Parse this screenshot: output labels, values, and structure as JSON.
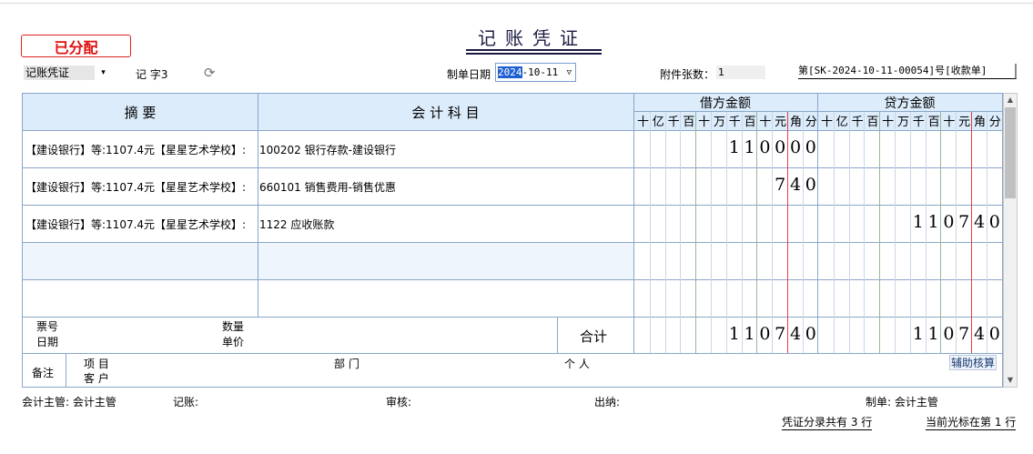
{
  "stamp": "已分配",
  "title": "记账凭证",
  "voucher_type": "记账凭证",
  "word_label": "记 字3",
  "date_label": "制单日期",
  "date_year": "2024",
  "date_rest": "-10-11",
  "attach_label": "附件张数：",
  "attach_value": "1",
  "voucher_no": "第[SK-2024-10-11-00054]号[收款单]",
  "headers": {
    "summary": "摘  要",
    "account": "会 计 科 目",
    "debit": "借方金额",
    "credit": "贷方金额",
    "units": [
      "十",
      "亿",
      "千",
      "百",
      "十",
      "万",
      "千",
      "百",
      "十",
      "元",
      "角",
      "分"
    ]
  },
  "rows": [
    {
      "summary": "【建设银行】等:1107.4元【星星艺术学校】:",
      "account": "100202 银行存款-建设银行",
      "debit": "110000",
      "credit": ""
    },
    {
      "summary": "【建设银行】等:1107.4元【星星艺术学校】:",
      "account": "660101 销售费用-销售优惠",
      "debit": "740",
      "credit": ""
    },
    {
      "summary": "【建设银行】等:1107.4元【星星艺术学校】:",
      "account": "1122 应收账款",
      "debit": "",
      "credit": "110740"
    },
    {
      "summary": "",
      "account": "",
      "debit": "",
      "credit": ""
    },
    {
      "summary": "",
      "account": "",
      "debit": "",
      "credit": ""
    }
  ],
  "bottom": {
    "ticket_no": "票号",
    "date": "日期",
    "quantity": "数量",
    "unit_price": "单价",
    "total_label": "合计",
    "total_debit": "110740",
    "total_credit": "110740"
  },
  "remark": {
    "label": "备注",
    "project": "项 目",
    "customer": "客 户",
    "dept": "部 门",
    "person": "个 人",
    "aux_button": "辅助核算"
  },
  "signatures": {
    "supervisor": "会计主管: 会计主管",
    "bookkeeper": "记账:",
    "auditor": "审核:",
    "cashier": "出纳:",
    "maker": "制单: 会计主管"
  },
  "status": {
    "rows_total": "凭证分录共有 3 行",
    "cursor": "当前光标在第 1 行"
  },
  "colors": {
    "header_bg": "#dcecfb",
    "grid": "#8aa6c8",
    "stamp": "#e01010",
    "yuan_line": "#e04040",
    "wan_line": "#2a8a2a"
  }
}
